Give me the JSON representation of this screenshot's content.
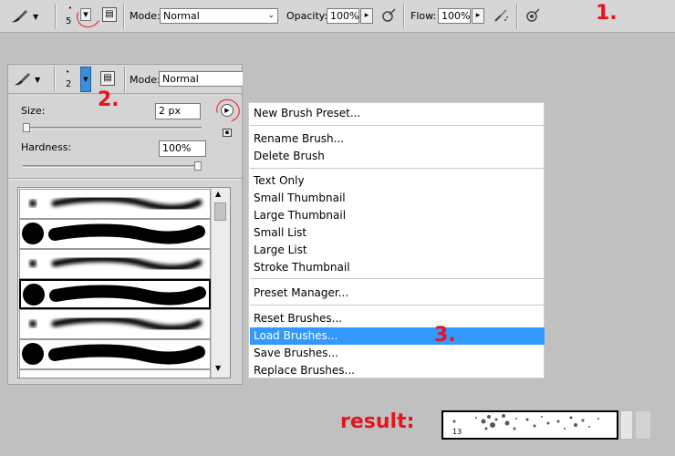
{
  "options_bar": {
    "brush_size": "5",
    "mode_label": "Mode:",
    "mode_value": "Normal",
    "opacity_label": "Opacity:",
    "opacity_value": "100%",
    "flow_label": "Flow:",
    "flow_value": "100%",
    "step_marker": "1."
  },
  "panel": {
    "brush_size": "2",
    "mode_label": "Mode:",
    "mode_value": "Normal",
    "size_label": "Size:",
    "size_value": "2 px",
    "size_level": 0.0,
    "hardness_label": "Hardness:",
    "hardness_value": "100%",
    "hardness_level": 1.0,
    "step_marker": "2.",
    "brushes": [
      {
        "tip": "soft",
        "selected": false
      },
      {
        "tip": "hard",
        "selected": false
      },
      {
        "tip": "soft",
        "selected": false
      },
      {
        "tip": "hard",
        "selected": true
      },
      {
        "tip": "soft",
        "selected": false
      },
      {
        "tip": "hard",
        "selected": false
      },
      {
        "tip": "soft",
        "selected": false
      }
    ]
  },
  "menu": {
    "items": [
      {
        "label": "New Brush Preset...",
        "highlighted": false
      },
      {
        "label": "Rename Brush...",
        "highlighted": false
      },
      {
        "label": "Delete Brush",
        "highlighted": false
      },
      {
        "label": "Text Only",
        "highlighted": false
      },
      {
        "label": "Small Thumbnail",
        "highlighted": false
      },
      {
        "label": "Large Thumbnail",
        "highlighted": false
      },
      {
        "label": "Small List",
        "highlighted": false
      },
      {
        "label": "Large List",
        "highlighted": false
      },
      {
        "label": "Stroke Thumbnail",
        "highlighted": false
      },
      {
        "label": "Preset Manager...",
        "highlighted": false
      },
      {
        "label": "Reset Brushes...",
        "highlighted": false
      },
      {
        "label": "Load Brushes...",
        "highlighted": true
      },
      {
        "label": "Save Brushes...",
        "highlighted": false
      },
      {
        "label": "Replace Brushes...",
        "highlighted": false
      }
    ],
    "step_marker": "3."
  },
  "result": {
    "label": "result:",
    "brush_number": "13"
  },
  "colors": {
    "accent_red": "#e8141c",
    "menu_highlight": "#3399ff"
  }
}
